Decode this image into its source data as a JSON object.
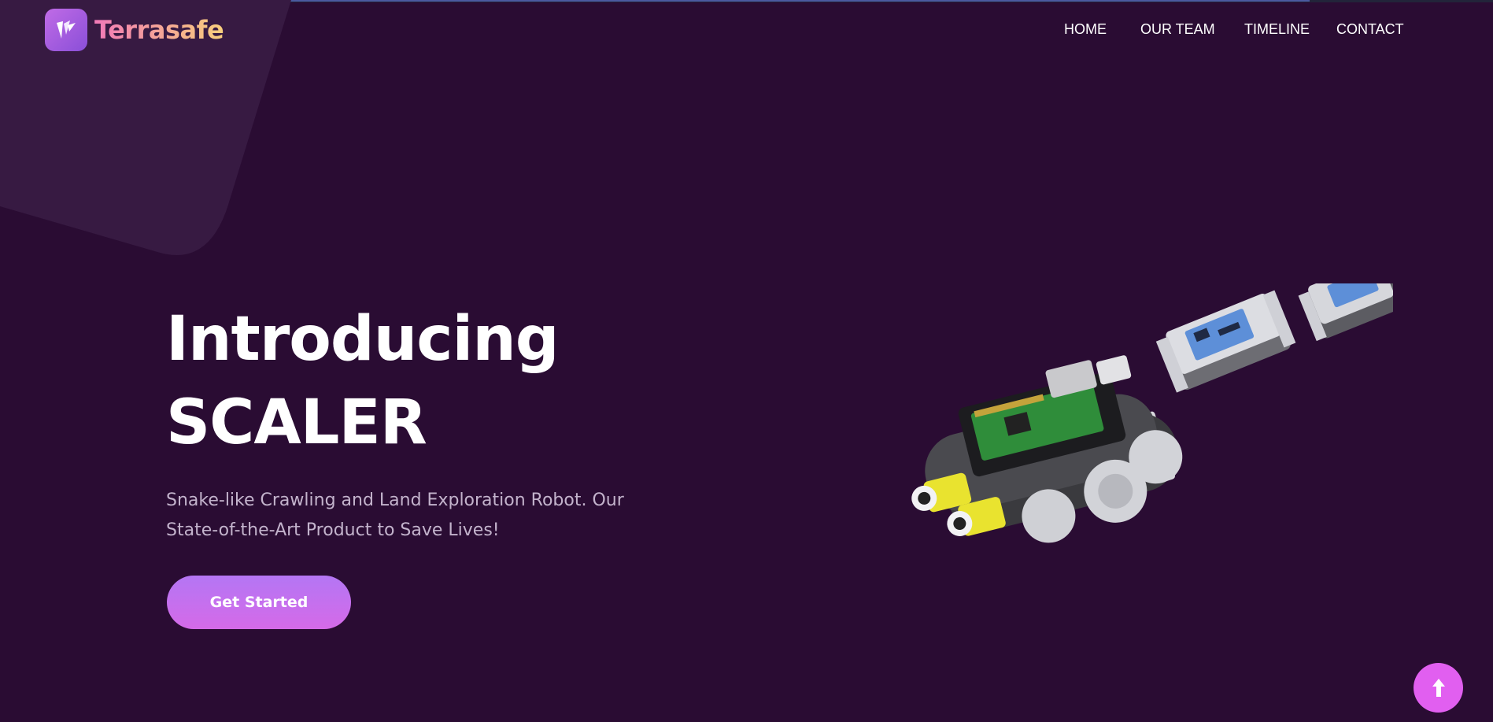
{
  "brand": {
    "name": "Terrasafe",
    "icon": "terrasafe-logo-icon"
  },
  "nav": {
    "items": [
      {
        "label": "HOME"
      },
      {
        "label": "OUR TEAM"
      },
      {
        "label": "TIMELINE"
      },
      {
        "label": "CONTACT"
      }
    ]
  },
  "hero": {
    "title_line1": "Introducing",
    "title_line2": "SCALER",
    "subtitle": "Snake-like Crawling and Land Exploration Robot. Our State-of-the-Art Product to Save Lives!",
    "cta_label": "Get Started",
    "image": "scaler-robot-render"
  },
  "scroll_top": {
    "icon": "arrow-up-icon"
  },
  "colors": {
    "background": "#2a0c33",
    "accent": "#c46ee8",
    "scroll_button": "#e15ff0",
    "subtitle_text": "#c3b3cc"
  }
}
